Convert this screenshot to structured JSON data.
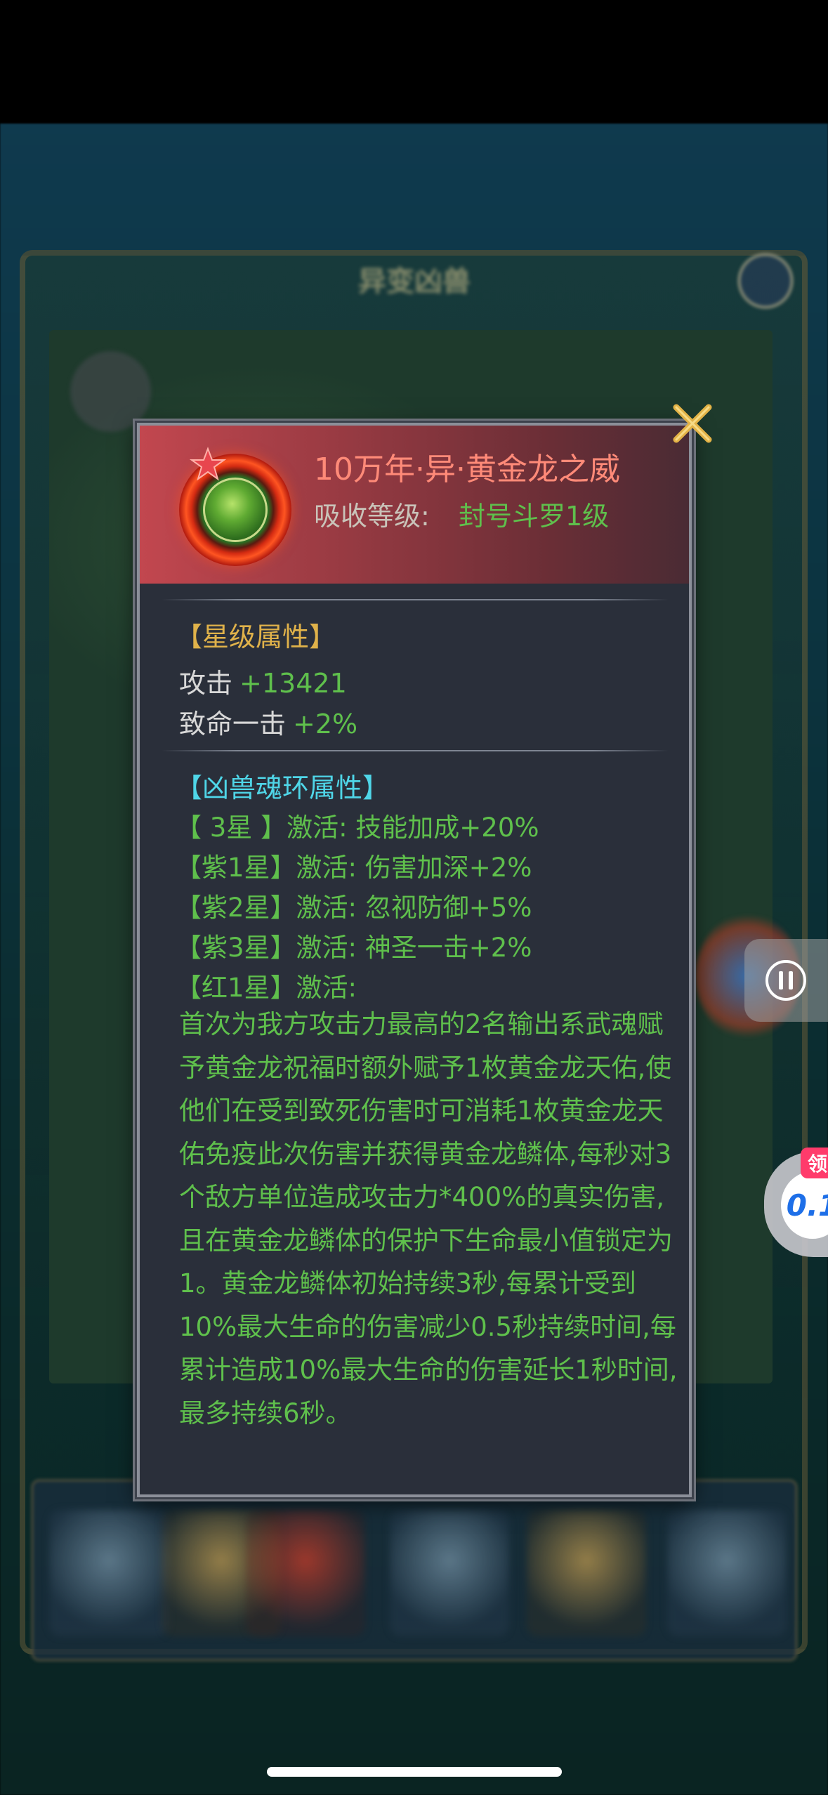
{
  "popup": {
    "item_name": "10万年·异·黄金龙之威",
    "absorb_label": "吸收等级:",
    "absorb_value": "封号斗罗1级",
    "star_section_title": "【星级属性】",
    "stats": [
      {
        "name": "攻击",
        "value": "+13421"
      },
      {
        "name": "致命一击",
        "value": "+2%"
      }
    ],
    "ring_section_title": "【凶兽魂环属性】",
    "activations": [
      "【 3星 】激活: 技能加成+20%",
      "【紫1星】激活: 伤害加深+2%",
      "【紫2星】激活: 忽视防御+5%",
      "【紫3星】激活: 神圣一击+2%",
      "【红1星】激活:"
    ],
    "red_star_description": "首次为我方攻击力最高的2名输出系武魂赋予黄金龙祝福时额外赋予1枚黄金龙天佑,使他们在受到致死伤害时可消耗1枚黄金龙天佑免疫此次伤害并获得黄金龙鳞体,每秒对3个敌方单位造成攻击力*400%的真实伤害,且在黄金龙鳞体的保护下生命最小值锁定为1。黄金龙鳞体初始持续3秒,每累计受到10%最大生命的伤害减少0.5秒持续时间,每累计造成10%最大生命的伤害延长1秒时间,最多持续6秒。"
  },
  "icons": {
    "close": "close-x-icon",
    "star": "star-icon",
    "ring": "soul-ring-icon",
    "pause": "pause-icon"
  },
  "background": {
    "title": "异变凶兽"
  },
  "widgets": {
    "promo_badge": "领",
    "promo_text": "0.1"
  },
  "colors": {
    "green_text": "#5fc04c",
    "gold_title": "#e0b24a",
    "cyan_title": "#4fd6e8",
    "name_red": "#ff8a78"
  }
}
